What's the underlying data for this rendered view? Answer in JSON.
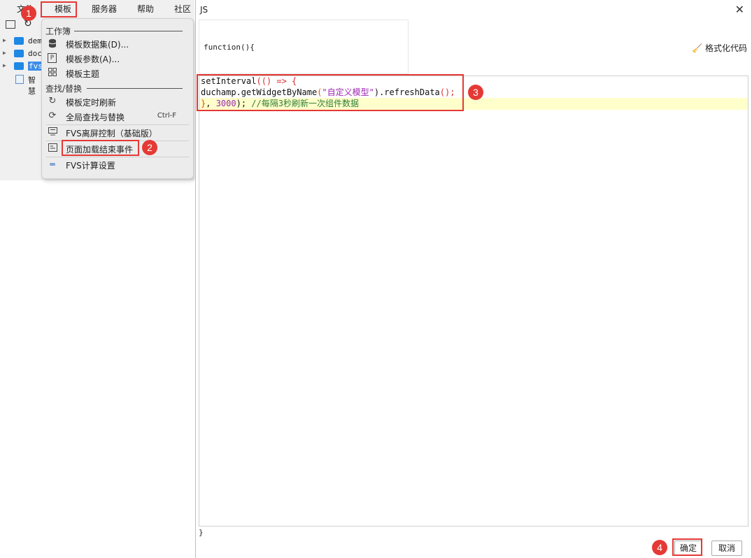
{
  "menubar": {
    "items": [
      "文件",
      "模板",
      "服务器",
      "帮助",
      "社区"
    ]
  },
  "tree": {
    "items": [
      "dem",
      "doc",
      "fvs",
      "智慧"
    ]
  },
  "dropdown": {
    "section_workbook": "工作簿",
    "section_find": "查找/替换",
    "items": [
      {
        "label": "模板数据集(D)...",
        "icon": "database-icon"
      },
      {
        "label": "模板参数(A)...",
        "icon": "parameter-icon"
      },
      {
        "label": "模板主题",
        "icon": "theme-grid-icon"
      },
      {
        "label": "模板定时刷新",
        "icon": "refresh-timer-icon"
      },
      {
        "label": "全局查找与替换",
        "icon": "search-replace-icon",
        "shortcut": "Ctrl-F"
      },
      {
        "label": "FVS离屏控制（基础版）",
        "icon": "monitor-icon"
      },
      {
        "label": "页面加载结束事件",
        "icon": "load-event-icon"
      },
      {
        "label": "FVS计算设置",
        "icon": "calc-settings-icon"
      }
    ]
  },
  "badges": [
    "1",
    "2",
    "3",
    "4"
  ],
  "dialog": {
    "title": "JS",
    "function_signature": "function(){",
    "format_button": "格式化代码",
    "closing_brace": "}",
    "ok_button": "确定",
    "cancel_button": "取消",
    "code": {
      "line1_a": "setInterval",
      "line1_b": "(() => {",
      "line2_a": "duchamp.getWidgetByName",
      "line2_b": "(",
      "line2_c": "\"自定义模型\"",
      "line2_d": ").refreshData",
      "line2_e": "();",
      "line3_a": "}",
      "line3_b": ", ",
      "line3_c": "3000",
      "line3_d": "); ",
      "line3_e": "//每隔3秒刷新一次组件数据"
    }
  },
  "colors": {
    "accent_red": "#e53935",
    "folder_blue": "#1e88e5",
    "highlight_line": "#ffffcc"
  }
}
